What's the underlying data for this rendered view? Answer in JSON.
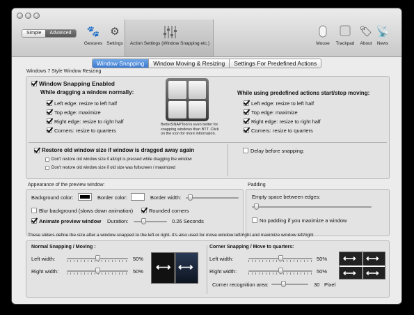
{
  "toolbar": {
    "mode_simple": "Simple",
    "mode_advanced": "Advanced",
    "items_left": [
      {
        "label": "Gestures",
        "icon": "paw-icon"
      },
      {
        "label": "Settings",
        "icon": "gear-icon"
      }
    ],
    "selected_item": {
      "label": "Action Settings (Window Snapping etc.)",
      "icon": "sliders-icon"
    },
    "items_right": [
      {
        "label": "Mouse",
        "icon": "mouse-icon"
      },
      {
        "label": "Trackpad",
        "icon": "trackpad-icon"
      },
      {
        "label": "About",
        "icon": "tag-icon"
      },
      {
        "label": "News",
        "icon": "antenna-icon"
      }
    ]
  },
  "tabs": [
    "Window Snapping",
    "Window Moving & Resizing",
    "Settings For Predefined Actions"
  ],
  "active_tab": 0,
  "win7": {
    "section_label": "Windows 7 Style Window Resizing",
    "enabled_label": "Window Snapping Enabled",
    "enabled": true,
    "drag_heading": "While dragging a window normally:",
    "drag_options": [
      {
        "label": "Left edge: resize to left half",
        "checked": true
      },
      {
        "label": "Top edge: maximize",
        "checked": true
      },
      {
        "label": "Right edge: resize to right half",
        "checked": true
      },
      {
        "label": "Corners: resize to quarters",
        "checked": true
      }
    ],
    "predef_heading": "While using predefined actions start/stop moving:",
    "predef_options": [
      {
        "label": "Left edge: resize to left half",
        "checked": true
      },
      {
        "label": "Top edge: maximize",
        "checked": true
      },
      {
        "label": "Right edge: resize to right half",
        "checked": true
      },
      {
        "label": "Corners: resize to quarters",
        "checked": true
      }
    ],
    "promo_text": "BetterSNAPTool is even better for snapping windows than BTT. Click on the icon for more information.",
    "restore_label": "Restore old window size if window is dragged away again",
    "restore_checked": true,
    "restore_sub": [
      {
        "label": "Don't restore old window size if alt/opt is pressed while dragging the window",
        "checked": false
      },
      {
        "label": "Don't restore old window size if old size was fullscreen / maximized",
        "checked": false
      }
    ],
    "delay_label": "Delay before snapping:",
    "delay_checked": false
  },
  "preview": {
    "section_label": "Appearance of the preview window:",
    "bg_color_label": "Background color:",
    "bg_color": "#000000",
    "border_color_label": "Border color:",
    "border_color": "#ffffff",
    "border_width_label": "Border width:",
    "border_width_value": 0.05,
    "blur_label": "Blur background (slows down animation)",
    "blur_checked": false,
    "rounded_label": "Rounded corners",
    "rounded_checked": true,
    "animate_label": "Animate preview window",
    "animate_checked": true,
    "duration_label": "Duration:",
    "duration_value": "0.26 Seconds",
    "duration_fraction": 0.26
  },
  "padding": {
    "section_label": "Padding",
    "empty_space_label": "Empty space between edges:",
    "empty_space_value": 0.02,
    "no_padding_label": "No padding if you maximize a window",
    "no_padding_checked": false
  },
  "sizes": {
    "description": "These sliders define the size after a window snapped to the left or right. It's also used for move window left/right and maximize window left/right",
    "normal_heading": "Normal Snapping / Moving :",
    "normal_rows": [
      {
        "label": "Left width:",
        "value": "50%",
        "fraction": 0.5
      },
      {
        "label": "Right width:",
        "value": "50%",
        "fraction": 0.5
      }
    ],
    "corner_heading": "Corner Snapping / Move to quarters:",
    "corner_rows": [
      {
        "label": "Left width:",
        "value": "50%",
        "fraction": 0.5
      },
      {
        "label": "Right width:",
        "value": "50%",
        "fraction": 0.5
      }
    ],
    "corner_area_label": "Corner recognition area:",
    "corner_area_value": "30",
    "corner_area_unit": "Pixel",
    "corner_area_fraction": 0.3
  },
  "colors": {
    "accent": "#3c7ad2",
    "window_bg": "#ececec"
  }
}
